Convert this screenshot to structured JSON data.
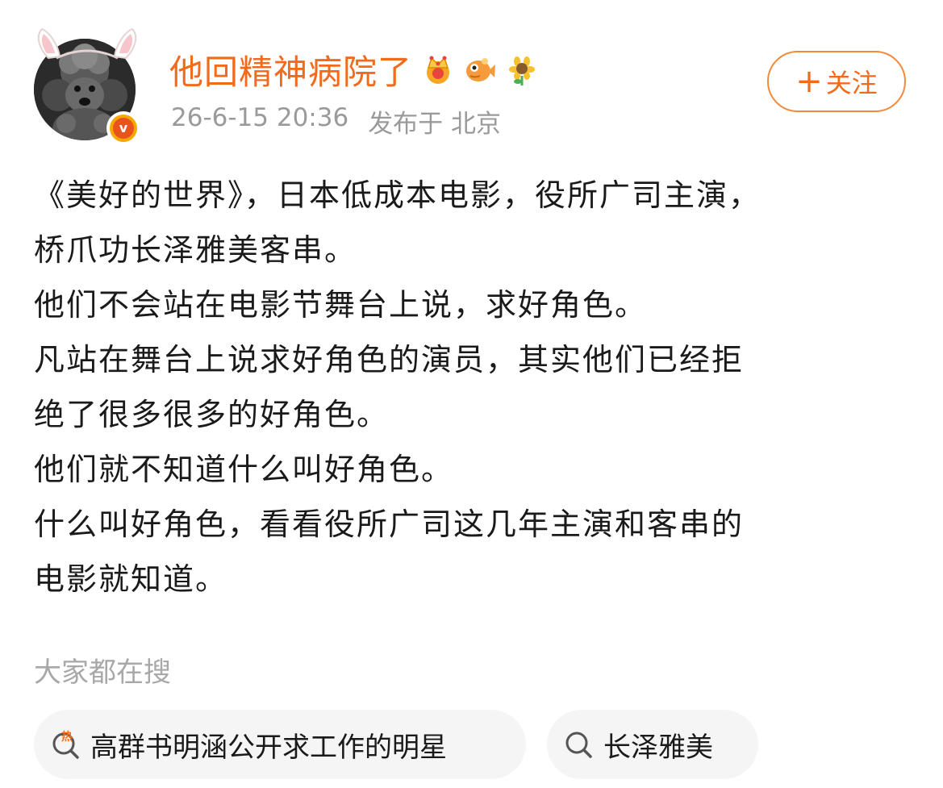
{
  "post": {
    "author": {
      "name": "他回精神病院了",
      "verified_badge_glyph": "v",
      "badge_icons": [
        "crown-badge-icon",
        "fish-badge-icon",
        "sunflower-badge-icon"
      ]
    },
    "meta": {
      "timestamp": "26-6-15 20:36",
      "location": "发布于 北京"
    },
    "follow_button": {
      "plus": "+",
      "label": "关注"
    },
    "body_lines": [
      "《美好的世界》，日本低成本电影，役所广司主演，",
      "桥爪功长泽雅美客串。",
      "他们不会站在电影节舞台上说，求好角色。",
      "凡站在舞台上说求好角色的演员，其实他们已经拒",
      "绝了很多很多的好角色。",
      "他们就不知道什么叫好角色。",
      "什么叫好角色，看看役所广司这几年主演和客串的",
      "电影就知道。"
    ]
  },
  "search": {
    "title": "大家都在搜",
    "chips": [
      {
        "label": "高群书明涵公开求工作的明星",
        "icon": "hot-search-icon",
        "hot_glyph": "热"
      },
      {
        "label": "长泽雅美",
        "icon": "search-icon"
      }
    ]
  },
  "colors": {
    "accent": "#f26b1d",
    "muted": "#9a9a9a",
    "text": "#1a1a1a",
    "chip_bg": "#f5f5f5"
  }
}
